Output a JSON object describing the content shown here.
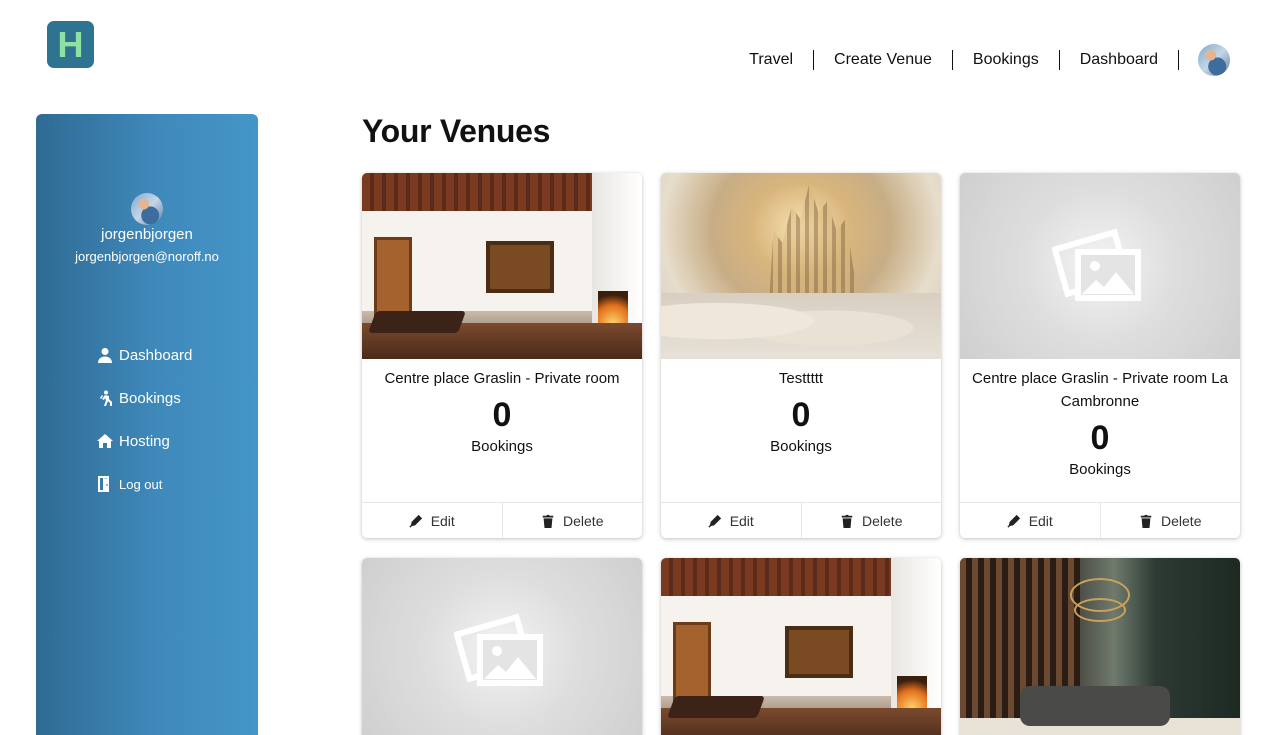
{
  "brand": {
    "logo_letter": "H"
  },
  "nav": {
    "items": [
      "Travel",
      "Create Venue",
      "Bookings",
      "Dashboard"
    ]
  },
  "sidebar": {
    "username": "jorgenbjorgen",
    "email": "jorgenbjorgen@noroff.no",
    "items": [
      {
        "label": "Dashboard",
        "icon": "user-icon"
      },
      {
        "label": "Bookings",
        "icon": "hiking-icon"
      },
      {
        "label": "Hosting",
        "icon": "home-icon"
      },
      {
        "label": "Log out",
        "icon": "door-icon"
      }
    ]
  },
  "main": {
    "heading": "Your Venues",
    "venues": [
      {
        "title": "Centre place Graslin - Private room",
        "count": "0",
        "count_label": "Bookings",
        "edit": "Edit",
        "delete": "Delete",
        "image": "villa"
      },
      {
        "title": "Testtttt",
        "count": "0",
        "count_label": "Bookings",
        "edit": "Edit",
        "delete": "Delete",
        "image": "clouds"
      },
      {
        "title": "Centre place Graslin - Private room La Cambronne",
        "count": "0",
        "count_label": "Bookings",
        "edit": "Edit",
        "delete": "Delete",
        "image": "placeholder"
      },
      {
        "image": "placeholder"
      },
      {
        "image": "villa"
      },
      {
        "image": "lounge"
      }
    ]
  },
  "colors": {
    "sidebar_start": "#2f6b93",
    "sidebar_end": "#4596c8",
    "logo_bg": "#2e7490",
    "logo_letter": "#8fe0a3"
  }
}
